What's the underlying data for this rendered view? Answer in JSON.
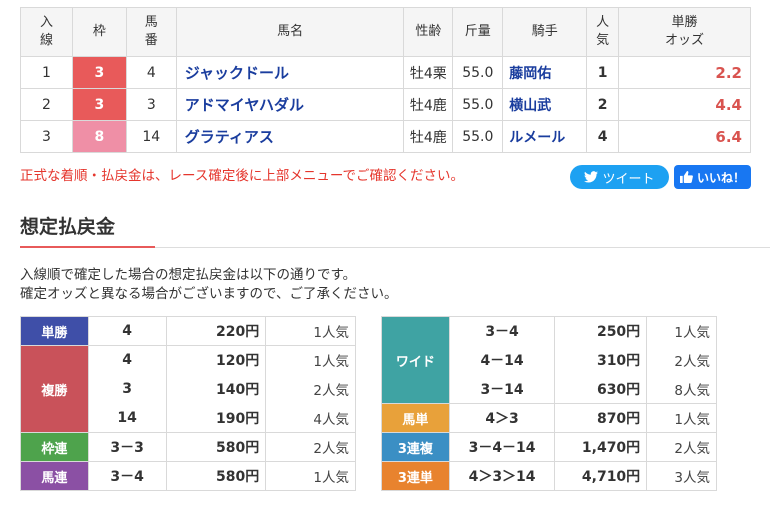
{
  "results": {
    "headers": {
      "rank": "入\n線",
      "waku": "枠",
      "umaban": "馬\n番",
      "name": "馬名",
      "sexage": "性齢",
      "weight": "斤量",
      "jockey": "騎手",
      "popularity": "人\n気",
      "odds": "単勝\nオッズ"
    },
    "rows": [
      {
        "rank": "1",
        "waku": "3",
        "umaban": "4",
        "name": "ジャックドール",
        "sexage": "牡4栗",
        "weight": "55.0",
        "jockey": "藤岡佑",
        "popularity": "1",
        "odds": "2.2",
        "waku_color": "#e85a5a"
      },
      {
        "rank": "2",
        "waku": "3",
        "umaban": "3",
        "name": "アドマイヤハダル",
        "sexage": "牡4鹿",
        "weight": "55.0",
        "jockey": "横山武",
        "popularity": "2",
        "odds": "4.4",
        "waku_color": "#e85a5a"
      },
      {
        "rank": "3",
        "waku": "8",
        "umaban": "14",
        "name": "グラティアス",
        "sexage": "牡4鹿",
        "weight": "55.0",
        "jockey": "ルメール",
        "popularity": "4",
        "odds": "6.4",
        "waku_color": "#ef8fa6"
      }
    ]
  },
  "notice": "正式な着順・払戻金は、レース確定後に上部メニューでご確認ください。",
  "share": {
    "tweet_label": "ツイート",
    "like_label": "いいね！"
  },
  "section": {
    "title": "想定払戻金",
    "desc_line1": "入線順で確定した場合の想定払戻金は以下の通りです。",
    "desc_line2": "確定オッズと異なる場合がございますので、ご了承ください。"
  },
  "payouts_left": {
    "tansho": {
      "label": "単勝",
      "color": "#3f4fa8",
      "rows": [
        {
          "num": "4",
          "yen": "220円",
          "pop": "1人気"
        }
      ]
    },
    "fukusho": {
      "label": "複勝",
      "color": "#c9525a",
      "rows": [
        {
          "num": "4",
          "yen": "120円",
          "pop": "1人気"
        },
        {
          "num": "3",
          "yen": "140円",
          "pop": "2人気"
        },
        {
          "num": "14",
          "yen": "190円",
          "pop": "4人気"
        }
      ]
    },
    "wakuren": {
      "label": "枠連",
      "color": "#4ea34c",
      "rows": [
        {
          "num": "3－3",
          "yen": "580円",
          "pop": "2人気"
        }
      ]
    },
    "umaren": {
      "label": "馬連",
      "color": "#8b50a4",
      "rows": [
        {
          "num": "3－4",
          "yen": "580円",
          "pop": "1人気"
        }
      ]
    }
  },
  "payouts_right": {
    "wide": {
      "label": "ワイド",
      "color": "#3fa3a3",
      "rows": [
        {
          "num": "3－4",
          "yen": "250円",
          "pop": "1人気"
        },
        {
          "num": "4－14",
          "yen": "310円",
          "pop": "2人気"
        },
        {
          "num": "3－14",
          "yen": "630円",
          "pop": "8人気"
        }
      ]
    },
    "umatan": {
      "label": "馬単",
      "color": "#e8a13a",
      "rows": [
        {
          "num": "4＞3",
          "yen": "870円",
          "pop": "1人気"
        }
      ]
    },
    "sanrenpuku": {
      "label": "3連複",
      "color": "#3b8fc4",
      "rows": [
        {
          "num": "3－4－14",
          "yen": "1,470円",
          "pop": "2人気"
        }
      ]
    },
    "sanrentan": {
      "label": "3連単",
      "color": "#e8832e",
      "rows": [
        {
          "num": "4＞3＞14",
          "yen": "4,710円",
          "pop": "3人気"
        }
      ]
    }
  }
}
